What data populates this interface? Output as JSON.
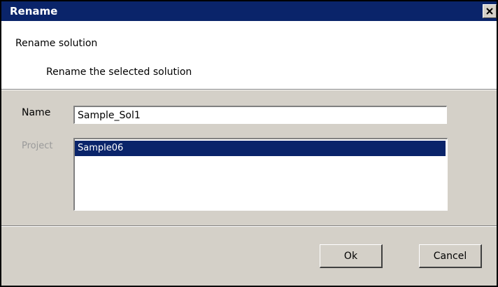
{
  "window": {
    "title": "Rename",
    "close_glyph": "✕"
  },
  "header": {
    "title": "Rename solution",
    "description": "Rename the selected solution"
  },
  "form": {
    "name_label": "Name",
    "name_value": "Sample_Sol1",
    "project_label": "Project",
    "projects": [
      "Sample06"
    ],
    "selected_project": "Sample06"
  },
  "buttons": {
    "ok_label": "Ok",
    "cancel_label": "Cancel"
  },
  "colors": {
    "titlebar": "#0a246a",
    "selection": "#0a246a",
    "dialog_bg": "#d4d0c8",
    "disabled_text": "#9a9a9a"
  },
  "icons": {
    "close": "close-icon"
  }
}
